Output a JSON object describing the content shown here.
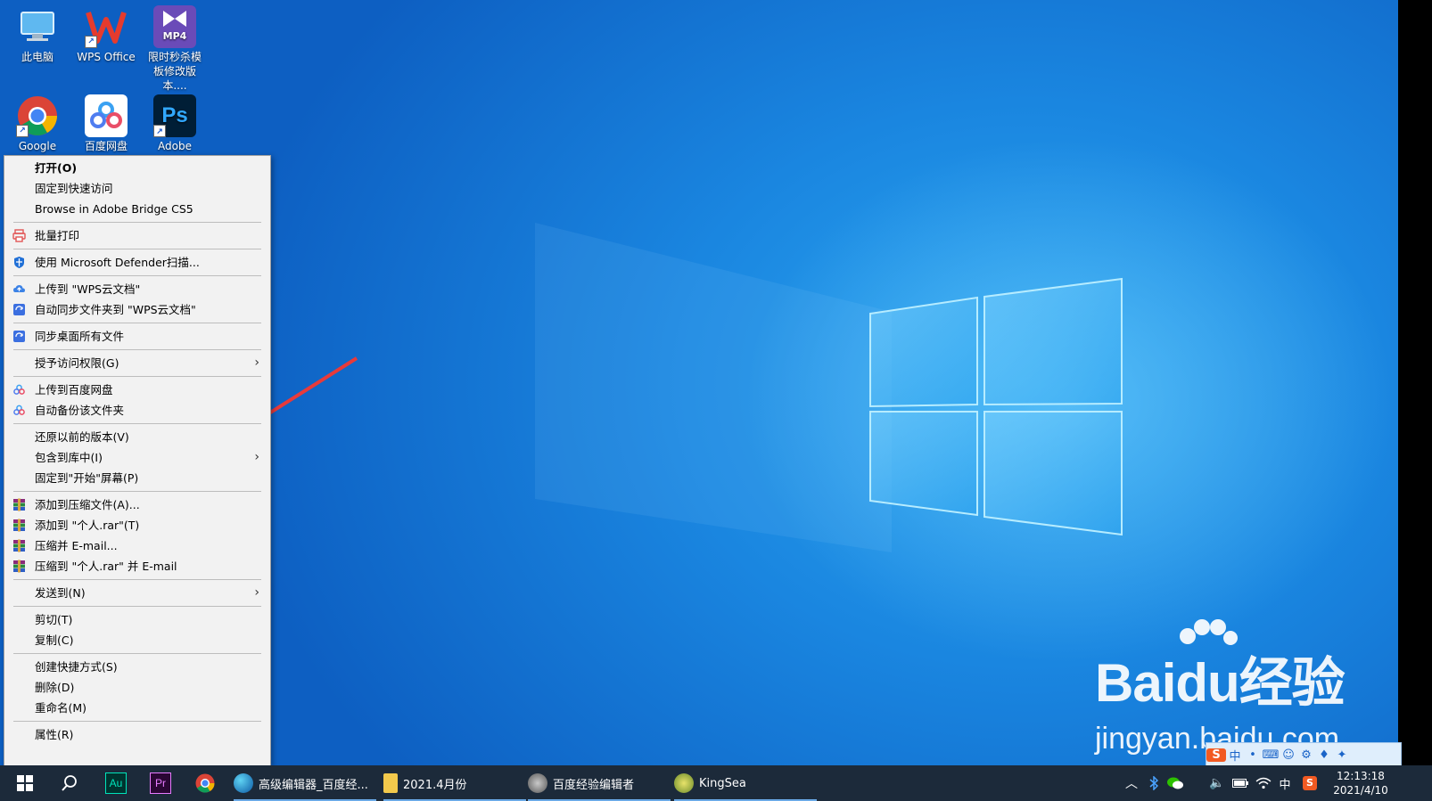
{
  "desktop_icons": [
    {
      "label": "此电脑",
      "icon": "computer-icon"
    },
    {
      "label": "WPS Office",
      "icon": "wps-icon"
    },
    {
      "label": "限时秒杀模板修改版本....",
      "icon": "mp4-file-icon",
      "badge": "MP4"
    },
    {
      "label": "Google",
      "icon": "chrome-icon"
    },
    {
      "label": "百度网盘",
      "icon": "baidu-netdisk-icon"
    },
    {
      "label": "Adobe",
      "icon": "photoshop-icon",
      "badge": "Ps"
    }
  ],
  "context_menu": {
    "items": [
      {
        "label": "打开(O)",
        "bold": true
      },
      {
        "label": "固定到快速访问"
      },
      {
        "label": "Browse in Adobe Bridge CS5"
      },
      {
        "label": "批量打印",
        "icon": "printer-icon"
      },
      {
        "label": "使用 Microsoft Defender扫描...",
        "icon": "defender-shield-icon"
      },
      {
        "label": "上传到 \"WPS云文档\"",
        "icon": "wps-cloud-icon"
      },
      {
        "label": "自动同步文件夹到 \"WPS云文档\"",
        "icon": "wps-sync-icon"
      },
      {
        "label": "同步桌面所有文件",
        "icon": "wps-sync-icon"
      },
      {
        "label": "授予访问权限(G)",
        "submenu": true
      },
      {
        "label": "上传到百度网盘",
        "icon": "baidu-netdisk-icon"
      },
      {
        "label": "自动备份该文件夹",
        "icon": "baidu-netdisk-icon"
      },
      {
        "label": "还原以前的版本(V)"
      },
      {
        "label": "包含到库中(I)",
        "submenu": true
      },
      {
        "label": "固定到\"开始\"屏幕(P)"
      },
      {
        "label": "添加到压缩文件(A)...",
        "icon": "winrar-icon"
      },
      {
        "label": "添加到 \"个人.rar\"(T)",
        "icon": "winrar-icon"
      },
      {
        "label": "压缩并 E-mail...",
        "icon": "winrar-icon"
      },
      {
        "label": "压缩到 \"个人.rar\" 并 E-mail",
        "icon": "winrar-icon"
      },
      {
        "label": "发送到(N)",
        "submenu": true
      },
      {
        "label": "剪切(T)"
      },
      {
        "label": "复制(C)"
      },
      {
        "label": "创建快捷方式(S)"
      },
      {
        "label": "删除(D)"
      },
      {
        "label": "重命名(M)"
      },
      {
        "label": "属性(R)"
      }
    ],
    "submenu_glyph": "›"
  },
  "taskbar": {
    "apps": [
      {
        "label": "高级编辑器_百度经...",
        "icon": "edge-icon"
      },
      {
        "label": "2021.4月份",
        "icon": "folder-icon"
      },
      {
        "label": "百度经验编辑者",
        "icon": "editor-app-icon"
      },
      {
        "label": "KingSea",
        "icon": "kingsea-icon"
      }
    ],
    "pinned": [
      {
        "icon": "audition-icon",
        "badge": "Au"
      },
      {
        "icon": "premiere-icon",
        "badge": "Pr"
      },
      {
        "icon": "chrome-icon"
      }
    ],
    "tray": {
      "ime": "中",
      "time": "12:13:18",
      "date": "2021/4/10"
    }
  },
  "watermark": {
    "brand_left": "Bai",
    "brand_mid": "du",
    "brand_right": "经验",
    "url": "jingyan.baidu.com"
  },
  "ime_toolbar": {
    "lang": "中",
    "punct": "◦",
    "items": [
      "中",
      "•",
      "⌨",
      "☺",
      "⚙",
      "♦",
      "✦"
    ]
  },
  "colors": {
    "desktop_blue": "#1a86e0",
    "arrow_red": "#e83a3a",
    "menu_bg": "#f2f2f2",
    "taskbar_bg": "#1c2a3a"
  }
}
